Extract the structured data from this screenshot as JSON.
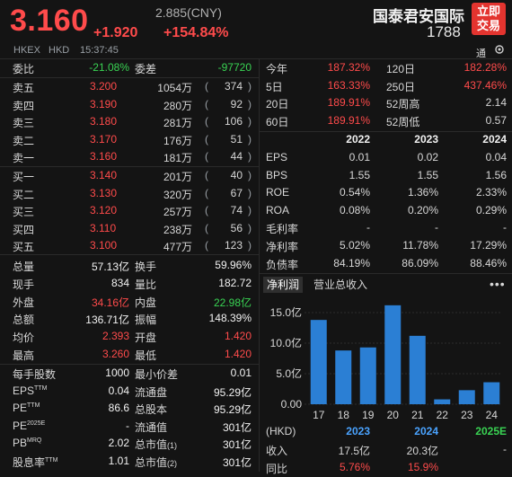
{
  "header": {
    "price": "3.160",
    "change": "+1.920",
    "change_pct": "+154.84%",
    "cny_price": "2.885(CNY)",
    "exchange": "HKEX",
    "currency": "HKD",
    "time": "15:37:45",
    "name": "国泰君安国际",
    "code": "1788",
    "trade_button": "立即\n交易",
    "tong": "通"
  },
  "top_stats": {
    "wei_bi_label": "委比",
    "wei_bi": "-21.08%",
    "wei_cha_label": "委差",
    "wei_cha": "-97720"
  },
  "order_book": [
    {
      "label": "卖五",
      "price": "3.200",
      "vol": "1054万",
      "cnt": "374"
    },
    {
      "label": "卖四",
      "price": "3.190",
      "vol": "280万",
      "cnt": "92"
    },
    {
      "label": "卖三",
      "price": "3.180",
      "vol": "281万",
      "cnt": "106"
    },
    {
      "label": "卖二",
      "price": "3.170",
      "vol": "176万",
      "cnt": "51"
    },
    {
      "label": "卖一",
      "price": "3.160",
      "vol": "181万",
      "cnt": "44"
    },
    {
      "label": "买一",
      "price": "3.140",
      "vol": "201万",
      "cnt": "40"
    },
    {
      "label": "买二",
      "price": "3.130",
      "vol": "320万",
      "cnt": "67"
    },
    {
      "label": "买三",
      "price": "3.120",
      "vol": "257万",
      "cnt": "74"
    },
    {
      "label": "买四",
      "price": "3.110",
      "vol": "238万",
      "cnt": "56"
    },
    {
      "label": "买五",
      "price": "3.100",
      "vol": "477万",
      "cnt": "123"
    }
  ],
  "stats": [
    {
      "l1": "总量",
      "v1": "57.13亿",
      "l2": "换手",
      "v2": "59.96%",
      "c1": "w",
      "c2": "w"
    },
    {
      "l1": "现手",
      "v1": "834",
      "l2": "量比",
      "v2": "182.72",
      "c1": "w",
      "c2": "w"
    },
    {
      "l1": "外盘",
      "v1": "34.16亿",
      "l2": "内盘",
      "v2": "22.98亿",
      "c1": "r",
      "c2": "g"
    },
    {
      "l1": "总额",
      "v1": "136.71亿",
      "l2": "振幅",
      "v2": "148.39%",
      "c1": "w",
      "c2": "w"
    },
    {
      "l1": "均价",
      "v1": "2.393",
      "l2": "开盘",
      "v2": "1.420",
      "c1": "r",
      "c2": "r"
    },
    {
      "l1": "最高",
      "v1": "3.260",
      "l2": "最低",
      "v2": "1.420",
      "c1": "r",
      "c2": "r"
    }
  ],
  "stats2": [
    {
      "l1": "每手股数",
      "v1": "1000",
      "l2": "最小价差",
      "v2": "0.01"
    },
    {
      "l1": "EPS",
      "s1": "TTM",
      "v1": "0.04",
      "l2": "流通盘",
      "v2": "95.29亿"
    },
    {
      "l1": "PE",
      "s1": "TTM",
      "v1": "86.6",
      "l2": "总股本",
      "v2": "95.29亿"
    },
    {
      "l1": "PE",
      "s1": "2025E",
      "v1": "-",
      "l2": "流通值",
      "v2": "301亿"
    },
    {
      "l1": "PB",
      "s1": "MRQ",
      "v1": "2.02",
      "l2": "总市值",
      "s2": "1",
      "v2": "301亿"
    },
    {
      "l1": "股息率",
      "s1": "TTM",
      "v1": "1.01",
      "l2": "总市值",
      "s2": "2",
      "v2": "301亿"
    }
  ],
  "performance": [
    {
      "l1": "今年",
      "v1": "187.32%",
      "l2": "120日",
      "v2": "182.28%",
      "c2": "r"
    },
    {
      "l1": "5日",
      "v1": "163.33%",
      "l2": "250日",
      "v2": "437.46%",
      "c2": "r"
    },
    {
      "l1": "20日",
      "v1": "189.91%",
      "l2": "52周高",
      "v2": "2.14",
      "c2": "w"
    },
    {
      "l1": "60日",
      "v1": "189.91%",
      "l2": "52周低",
      "v2": "0.57",
      "c2": "w"
    }
  ],
  "financials": {
    "years": [
      "2022",
      "2023",
      "2024"
    ],
    "rows": [
      {
        "label": "EPS",
        "vals": [
          "0.01",
          "0.02",
          "0.04"
        ]
      },
      {
        "label": "BPS",
        "vals": [
          "1.55",
          "1.55",
          "1.56"
        ]
      },
      {
        "label": "ROE",
        "vals": [
          "0.54%",
          "1.36%",
          "2.33%"
        ]
      },
      {
        "label": "ROA",
        "vals": [
          "0.08%",
          "0.20%",
          "0.29%"
        ]
      },
      {
        "label": "毛利率",
        "vals": [
          "-",
          "-",
          "-"
        ]
      },
      {
        "label": "净利率",
        "vals": [
          "5.02%",
          "11.78%",
          "17.29%"
        ]
      },
      {
        "label": "负债率",
        "vals": [
          "84.19%",
          "86.09%",
          "88.46%"
        ]
      }
    ]
  },
  "tabs": {
    "active": "净利润",
    "other": "营业总收入",
    "more": "•••"
  },
  "chart_data": {
    "type": "bar",
    "categories": [
      "17",
      "18",
      "19",
      "20",
      "21",
      "22",
      "23",
      "24"
    ],
    "values": [
      13.8,
      8.8,
      9.3,
      16.2,
      11.2,
      0.8,
      2.3,
      3.6
    ],
    "ylim": [
      0,
      15
    ],
    "yticks": [
      "15.0亿",
      "10.0亿",
      "5.0亿",
      "0.00"
    ],
    "color": "#2b7fd4"
  },
  "revenue": {
    "head": [
      "(HKD)",
      "2023",
      "2024",
      "2025E"
    ],
    "rows": [
      {
        "label": "收入",
        "vals": [
          "17.5亿",
          "20.3亿",
          "-"
        ]
      },
      {
        "label": "同比",
        "vals": [
          "5.76%",
          "15.9%",
          ""
        ]
      }
    ]
  }
}
